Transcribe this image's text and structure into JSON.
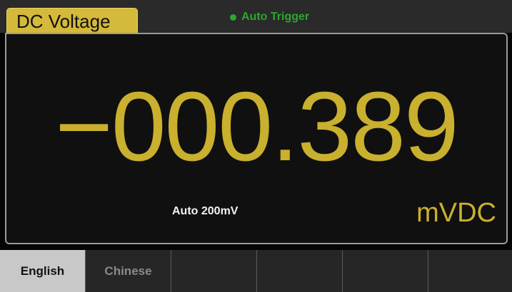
{
  "header": {
    "mode_title": "DC Voltage",
    "trigger_label": "Auto  Trigger"
  },
  "display": {
    "reading": "−000.389",
    "range": "Auto  200mV",
    "unit": "mVDC"
  },
  "softkeys": [
    {
      "label": "English",
      "active": true
    },
    {
      "label": "Chinese",
      "active": false
    },
    {
      "label": "",
      "active": false
    },
    {
      "label": "",
      "active": false
    },
    {
      "label": "",
      "active": false
    },
    {
      "label": "",
      "active": false
    }
  ],
  "colors": {
    "accent_yellow": "#c9b02e",
    "tab_yellow": "#d4b93a",
    "trigger_green": "#2fa52f",
    "range_text": "#f2f2f2"
  }
}
